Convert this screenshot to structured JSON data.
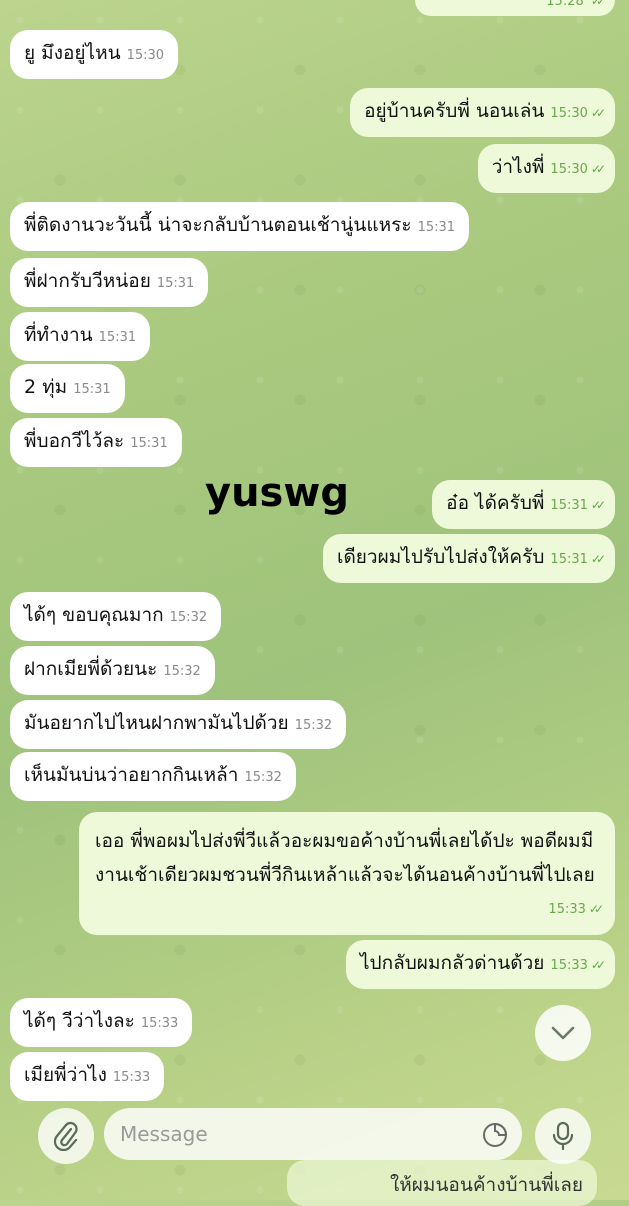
{
  "top_partial": {
    "time": "15:28"
  },
  "messages": [
    {
      "text": "ยู มึงอยู่ไหน",
      "time": "15:30"
    },
    {
      "text": "อยู่บ้านครับพี่ นอนเล่น",
      "time": "15:30"
    },
    {
      "text": "ว่าไงพี่",
      "time": "15:30"
    },
    {
      "text": "พี่ติดงานวะวันนี้ น่าจะกลับบ้านตอนเช้านู่นแหระ",
      "time": "15:31"
    },
    {
      "text": "พี่ฝากรับวีหน่อย",
      "time": "15:31"
    },
    {
      "text": "ที่ทำงาน",
      "time": "15:31"
    },
    {
      "text": "2 ทุ่ม",
      "time": "15:31"
    },
    {
      "text": "พี่บอกวีไว้ละ",
      "time": "15:31"
    },
    {
      "text": "อ๋อ ได้ครับพี่",
      "time": "15:31"
    },
    {
      "text": "เดียวผมไปรับไปส่งให้ครับ",
      "time": "15:31"
    },
    {
      "text": "ได้ๆ ขอบคุณมาก",
      "time": "15:32"
    },
    {
      "text": "ฝากเมียพี่ด้วยนะ",
      "time": "15:32"
    },
    {
      "text": "มันอยากไปไหนฝากพามันไปด้วย",
      "time": "15:32"
    },
    {
      "text": "เห็นมันบ่นว่าอยากกินเหล้า",
      "time": "15:32"
    },
    {
      "text": "เออ พี่พอผมไปส่งพี่วีแล้วอะผมขอค้างบ้านพี่เลยได้ปะ พอดีผมมีงานเช้าเดียวผมชวนพี่วีกินเหล้าแล้วจะได้นอนค้างบ้านพี่ไปเลย",
      "time": "15:33"
    },
    {
      "text": "ไปกลับผมกลัวด่านด้วย",
      "time": "15:33"
    },
    {
      "text": "ได้ๆ วีว่าไงละ",
      "time": "15:33"
    },
    {
      "text": "เมียพี่ว่าไง",
      "time": "15:33"
    }
  ],
  "watermark": "yuswg",
  "composer": {
    "placeholder": "Message"
  },
  "bottom_partial": {
    "text": "ให้ผมนอนค้างบ้านพี่เลย"
  },
  "read_check": "✓✓",
  "colors": {
    "incoming": "#ffffff",
    "outgoing": "#eef9d9",
    "check": "#5fa843"
  }
}
